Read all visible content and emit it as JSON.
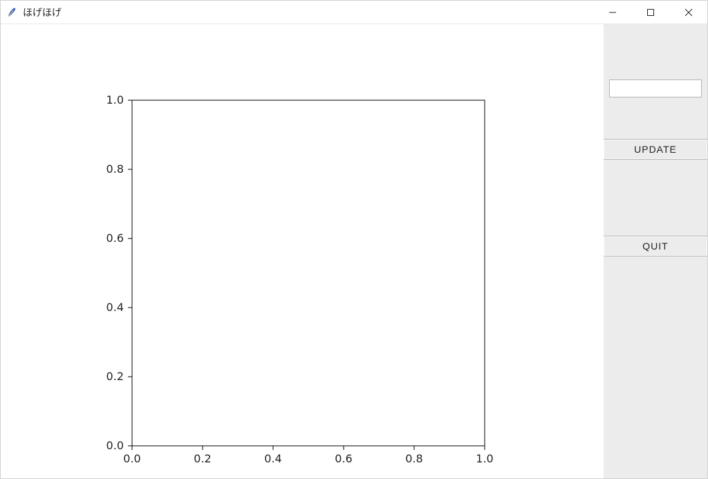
{
  "window": {
    "title": "ほげほげ"
  },
  "sidebar": {
    "entry_value": "",
    "update_label": "UPDATE",
    "quit_label": "QUIT"
  },
  "chart_data": {
    "type": "line",
    "series": [],
    "x_ticks": [
      "0.0",
      "0.2",
      "0.4",
      "0.6",
      "0.8",
      "1.0"
    ],
    "y_ticks": [
      "0.0",
      "0.2",
      "0.4",
      "0.6",
      "0.8",
      "1.0"
    ],
    "xlabel": "",
    "ylabel": "",
    "title": "",
    "xlim": [
      0.0,
      1.0
    ],
    "ylim": [
      0.0,
      1.0
    ]
  }
}
